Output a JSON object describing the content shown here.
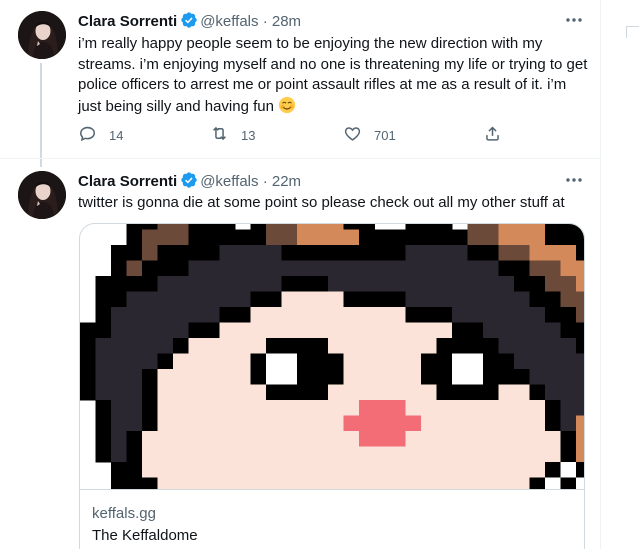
{
  "tweets": [
    {
      "author_name": "Clara Sorrenti",
      "handle": "@keffals",
      "separator": "·",
      "time": "28m",
      "text": "i’m really happy people seem to be enjoying the new direction with my streams. i’m enjoying myself and no one is threatening my life or trying to get police officers to arrest me or point assault rifles at me as a result of it. i’m just being silly and having fun",
      "emoji_icon": "smiling-face-with-smiling-eyes-icon",
      "reply_count": "14",
      "retweet_count": "13",
      "like_count": "701"
    },
    {
      "author_name": "Clara Sorrenti",
      "handle": "@keffals",
      "separator": "·",
      "time": "22m",
      "text": "twitter is gonna die at some point so please check out all my other stuff at",
      "card": {
        "domain": "keffals.gg",
        "title": "The Keffaldome",
        "image_description_icon": "pixel-art-character-icon"
      }
    }
  ],
  "icons": {
    "verified": "verified-badge-icon",
    "more": "more-options-icon",
    "reply": "reply-icon",
    "retweet": "retweet-icon",
    "like": "like-icon",
    "share": "share-icon"
  },
  "colors": {
    "verified_blue": "#1d9bf0",
    "secondary_text": "#536471",
    "primary_text": "#0f1419",
    "border": "#cfd9de"
  }
}
